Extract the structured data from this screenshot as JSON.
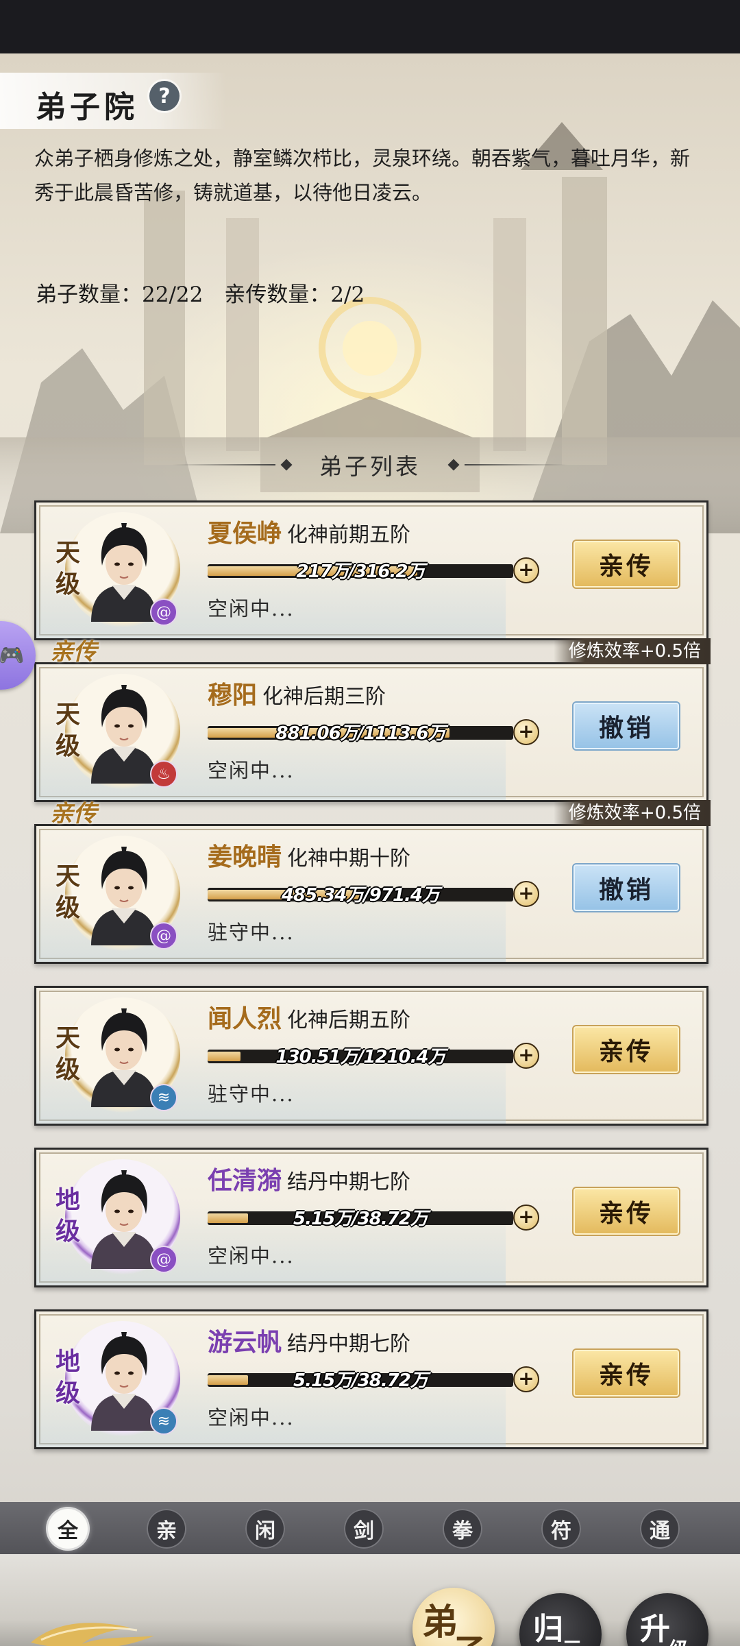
{
  "header": {
    "title": "弟子院",
    "help_icon": "?",
    "description": "众弟子栖身修炼之处，静室鳞次栉比，灵泉环绕。朝吞紫气，暮吐月华，新秀于此晨昏苦修，铸就道基，以待他日凌云。",
    "counts": "弟子数量：22/22　亲传数量：2/2"
  },
  "list_title": "弟子列表",
  "disciples": [
    {
      "rank": "天级",
      "rank_tier": "gold",
      "name": "夏侯峥",
      "realm": "化神前期五阶",
      "progress_text": "217万/316.2万",
      "progress": 0.686,
      "status": "空闲中...",
      "button": "亲传",
      "button_style": "gold",
      "is_direct": false,
      "tag": "",
      "efficiency": "",
      "element_icon": "swirl-icon",
      "element_color": "#8a4fc2"
    },
    {
      "rank": "天级",
      "rank_tier": "gold",
      "name": "穆阳",
      "realm": "化神后期三阶",
      "progress_text": "881.06万/1113.6万",
      "progress": 0.791,
      "status": "空闲中...",
      "button": "撤销",
      "button_style": "blue",
      "is_direct": true,
      "tag": "亲传",
      "efficiency": "修炼效率+0.5倍",
      "element_icon": "fire-icon",
      "element_color": "#c23a3a"
    },
    {
      "rank": "天级",
      "rank_tier": "gold",
      "name": "姜晚晴",
      "realm": "化神中期十阶",
      "progress_text": "485.34万/971.4万",
      "progress": 0.5,
      "status": "驻守中...",
      "button": "撤销",
      "button_style": "blue",
      "is_direct": true,
      "tag": "亲传",
      "efficiency": "修炼效率+0.5倍",
      "element_icon": "swirl-icon",
      "element_color": "#8a4fc2"
    },
    {
      "rank": "天级",
      "rank_tier": "gold",
      "name": "闻人烈",
      "realm": "化神后期五阶",
      "progress_text": "130.51万/1210.4万",
      "progress": 0.108,
      "status": "驻守中...",
      "button": "亲传",
      "button_style": "gold",
      "is_direct": false,
      "tag": "",
      "efficiency": "",
      "element_icon": "water-icon",
      "element_color": "#3b7fb5"
    },
    {
      "rank": "地级",
      "rank_tier": "purple",
      "name": "任清漪",
      "realm": "结丹中期七阶",
      "progress_text": "5.15万/38.72万",
      "progress": 0.133,
      "status": "空闲中...",
      "button": "亲传",
      "button_style": "gold",
      "is_direct": false,
      "tag": "",
      "efficiency": "",
      "element_icon": "swirl-icon",
      "element_color": "#8a4fc2"
    },
    {
      "rank": "地级",
      "rank_tier": "purple",
      "name": "游云帆",
      "realm": "结丹中期七阶",
      "progress_text": "5.15万/38.72万",
      "progress": 0.133,
      "status": "空闲中...",
      "button": "亲传",
      "button_style": "gold",
      "is_direct": false,
      "tag": "",
      "efficiency": "",
      "element_icon": "water-icon",
      "element_color": "#3b7fb5"
    }
  ],
  "filters": [
    "全",
    "亲",
    "闲",
    "剑",
    "拳",
    "符",
    "通"
  ],
  "active_filter": "全",
  "bottom_nav": [
    {
      "main": "弟",
      "sub": "子",
      "active": true
    },
    {
      "main": "归",
      "sub": "元",
      "active": false
    },
    {
      "main": "升",
      "sub": "级",
      "active": false
    }
  ],
  "side_widget_icon": "gamepad-icon"
}
